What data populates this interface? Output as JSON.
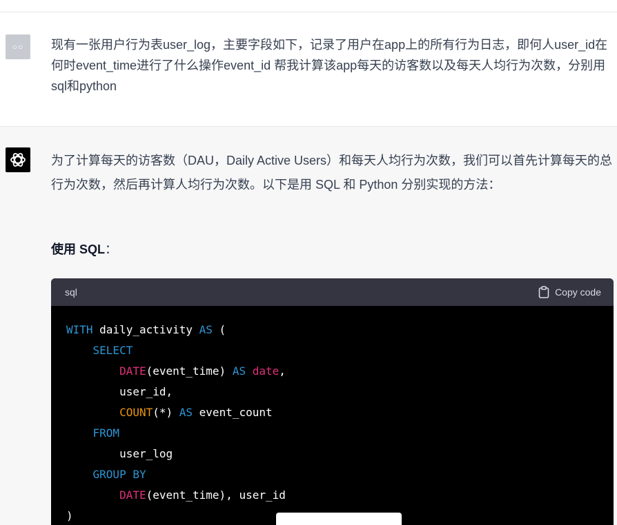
{
  "conversation": {
    "user": {
      "avatar_text": "○○",
      "message": "现有一张用户行为表user_log，主要字段如下，记录了用户在app上的所有行为日志，即何人user_id在何时event_time进行了什么操作event_id 帮我计算该app每天的访客数以及每天人均行为次数，分别用sql和python"
    },
    "assistant": {
      "intro": "为了计算每天的访客数（DAU，Daily Active Users）和每天人均行为次数，我们可以首先计算每天的总行为次数，然后再计算人均行为次数。以下是用 SQL 和 Python 分别实现的方法：",
      "sql_heading_bold": "使用 SQL",
      "sql_heading_suffix": "：",
      "code": {
        "language": "sql",
        "copy_label": "Copy code",
        "lines": [
          [
            {
              "t": "WITH",
              "c": "kw"
            },
            {
              "t": " daily_activity "
            },
            {
              "t": "AS",
              "c": "kw"
            },
            {
              "t": " ("
            }
          ],
          [
            {
              "t": "    "
            },
            {
              "t": "SELECT",
              "c": "kw"
            }
          ],
          [
            {
              "t": "        "
            },
            {
              "t": "DATE",
              "c": "fn"
            },
            {
              "t": "(event_time) "
            },
            {
              "t": "AS",
              "c": "kw"
            },
            {
              "t": " "
            },
            {
              "t": "date",
              "c": "fn"
            },
            {
              "t": ","
            }
          ],
          [
            {
              "t": "        user_id,"
            }
          ],
          [
            {
              "t": "        "
            },
            {
              "t": "COUNT",
              "c": "bi"
            },
            {
              "t": "(*) "
            },
            {
              "t": "AS",
              "c": "kw"
            },
            {
              "t": " event_count"
            }
          ],
          [
            {
              "t": "    "
            },
            {
              "t": "FROM",
              "c": "kw"
            }
          ],
          [
            {
              "t": "        user_log"
            }
          ],
          [
            {
              "t": "    "
            },
            {
              "t": "GROUP BY",
              "c": "kw"
            }
          ],
          [
            {
              "t": "        "
            },
            {
              "t": "DATE",
              "c": "fn"
            },
            {
              "t": "(event_time), user_id"
            }
          ],
          [
            {
              "t": ")"
            }
          ]
        ]
      }
    }
  },
  "colors": {
    "keyword": "#2e95d3",
    "function": "#df3079",
    "builtin": "#e9950c",
    "code_bg": "#000000",
    "code_header_bg": "#343541",
    "assistant_bg": "#f7f7f8"
  },
  "icons": {
    "assistant_avatar": "openai-logo-icon",
    "copy": "clipboard-icon"
  }
}
